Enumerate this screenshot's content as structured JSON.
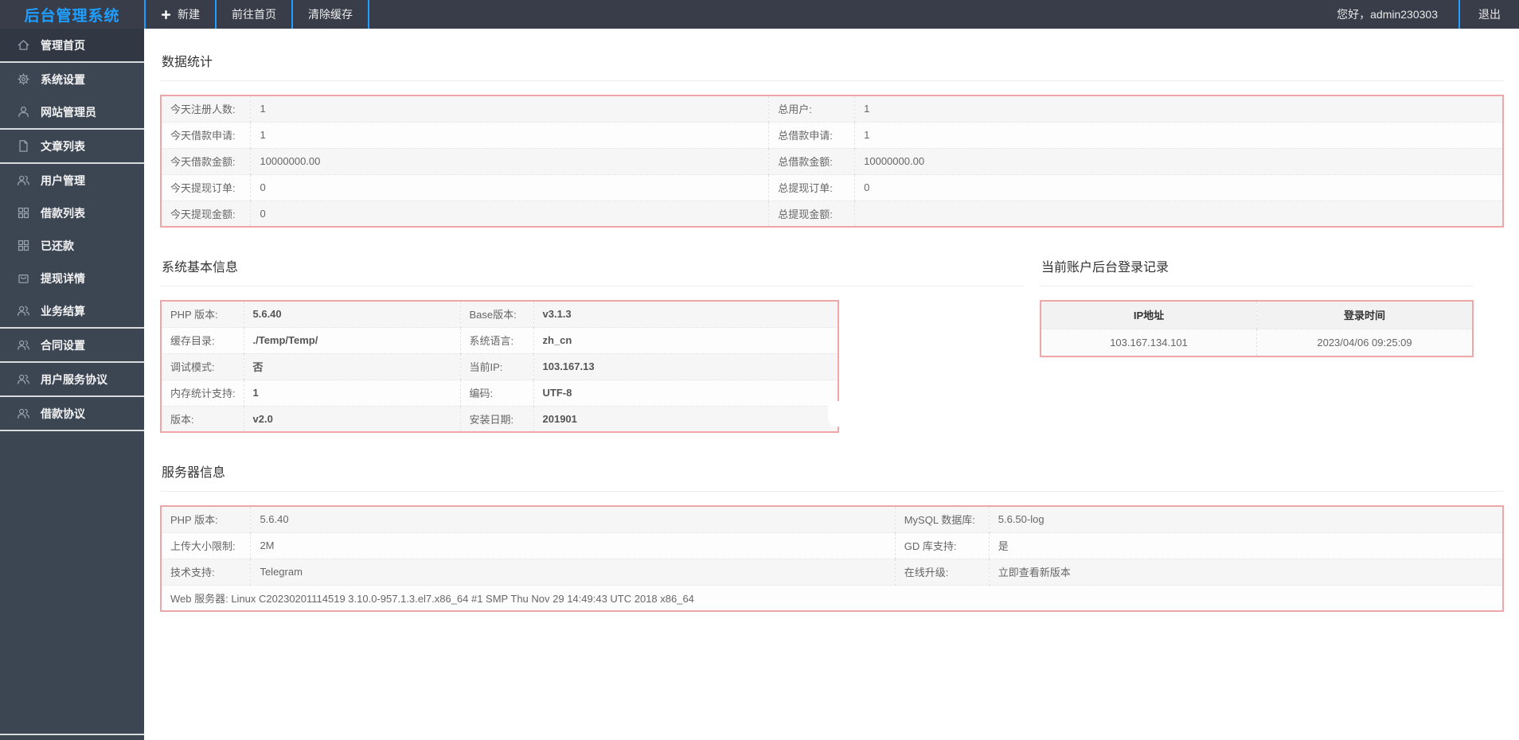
{
  "app": {
    "title": "后台管理系统"
  },
  "colors": {
    "accent": "#1E9FFF",
    "header_bg": "#393D49",
    "sidebar_bg": "#3C4653",
    "table_border": "#EFA6A6"
  },
  "header": {
    "nav": [
      {
        "label": "新建",
        "icon": "plus-icon"
      },
      {
        "label": "前往首页",
        "icon": ""
      },
      {
        "label": "清除缓存",
        "icon": ""
      }
    ],
    "greeting": "您好，admin230303",
    "logout": "退出"
  },
  "sidebar": {
    "items": [
      {
        "label": "管理首页",
        "icon": "home",
        "active": true,
        "divider_after": true
      },
      {
        "label": "系统设置",
        "icon": "gear",
        "active": false,
        "divider_after": false
      },
      {
        "label": "网站管理员",
        "icon": "user",
        "active": false,
        "divider_after": true
      },
      {
        "label": "文章列表",
        "icon": "file",
        "active": false,
        "divider_after": true
      },
      {
        "label": "用户管理",
        "icon": "users",
        "active": false,
        "divider_after": false
      },
      {
        "label": "借款列表",
        "icon": "grid",
        "active": false,
        "divider_after": false
      },
      {
        "label": "已还款",
        "icon": "grid",
        "active": false,
        "divider_after": false
      },
      {
        "label": "提现详情",
        "icon": "bag",
        "active": false,
        "divider_after": false
      },
      {
        "label": "业务结算",
        "icon": "users",
        "active": false,
        "divider_after": true
      },
      {
        "label": "合同设置",
        "icon": "users",
        "active": false,
        "divider_after": true
      },
      {
        "label": "用户服务协议",
        "icon": "users",
        "active": false,
        "divider_after": true
      },
      {
        "label": "借款协议",
        "icon": "users",
        "active": false,
        "divider_after": true
      }
    ]
  },
  "stats": {
    "title": "数据统计",
    "rows": [
      [
        "今天注册人数:",
        "1",
        "总用户:",
        "1"
      ],
      [
        "今天借款申请:",
        "1",
        "总借款申请:",
        "1"
      ],
      [
        "今天借款金额:",
        "10000000.00",
        "总借款金额:",
        "10000000.00"
      ],
      [
        "今天提现订单:",
        "0",
        "总提现订单:",
        "0"
      ],
      [
        "今天提现金额:",
        "0",
        "总提现金额:",
        ""
      ]
    ]
  },
  "sysinfo": {
    "title": "系统基本信息",
    "rows": [
      [
        "PHP 版本:",
        "5.6.40",
        "Base版本:",
        "v3.1.3"
      ],
      [
        "缓存目录:",
        "./Temp/Temp/",
        "系统语言:",
        "zh_cn"
      ],
      [
        "调试模式:",
        "否",
        "当前IP:",
        "103.167.13"
      ],
      [
        "内存统计支持:",
        "1",
        "编码:",
        "UTF-8"
      ],
      [
        "版本:",
        "v2.0",
        "安装日期:",
        "201901"
      ]
    ]
  },
  "login_log": {
    "title": "当前账户后台登录记录",
    "headers": [
      "IP地址",
      "登录时间"
    ],
    "rows": [
      [
        "103.167.134.101",
        "2023/04/06 09:25:09"
      ]
    ]
  },
  "server": {
    "title": "服务器信息",
    "link_label": "立即查看新版本",
    "rows": [
      [
        "PHP 版本:",
        "5.6.40",
        "MySQL 数据库:",
        "5.6.50-log"
      ],
      [
        "上传大小限制:",
        "2M",
        "GD 库支持:",
        "是"
      ],
      [
        "技术支持:",
        "Telegram",
        "在线升级:",
        "立即查看新版本"
      ]
    ],
    "footer": "Web 服务器: Linux C20230201114519 3.10.0-957.1.3.el7.x86_64 #1 SMP Thu Nov 29 14:49:43 UTC 2018 x86_64"
  }
}
